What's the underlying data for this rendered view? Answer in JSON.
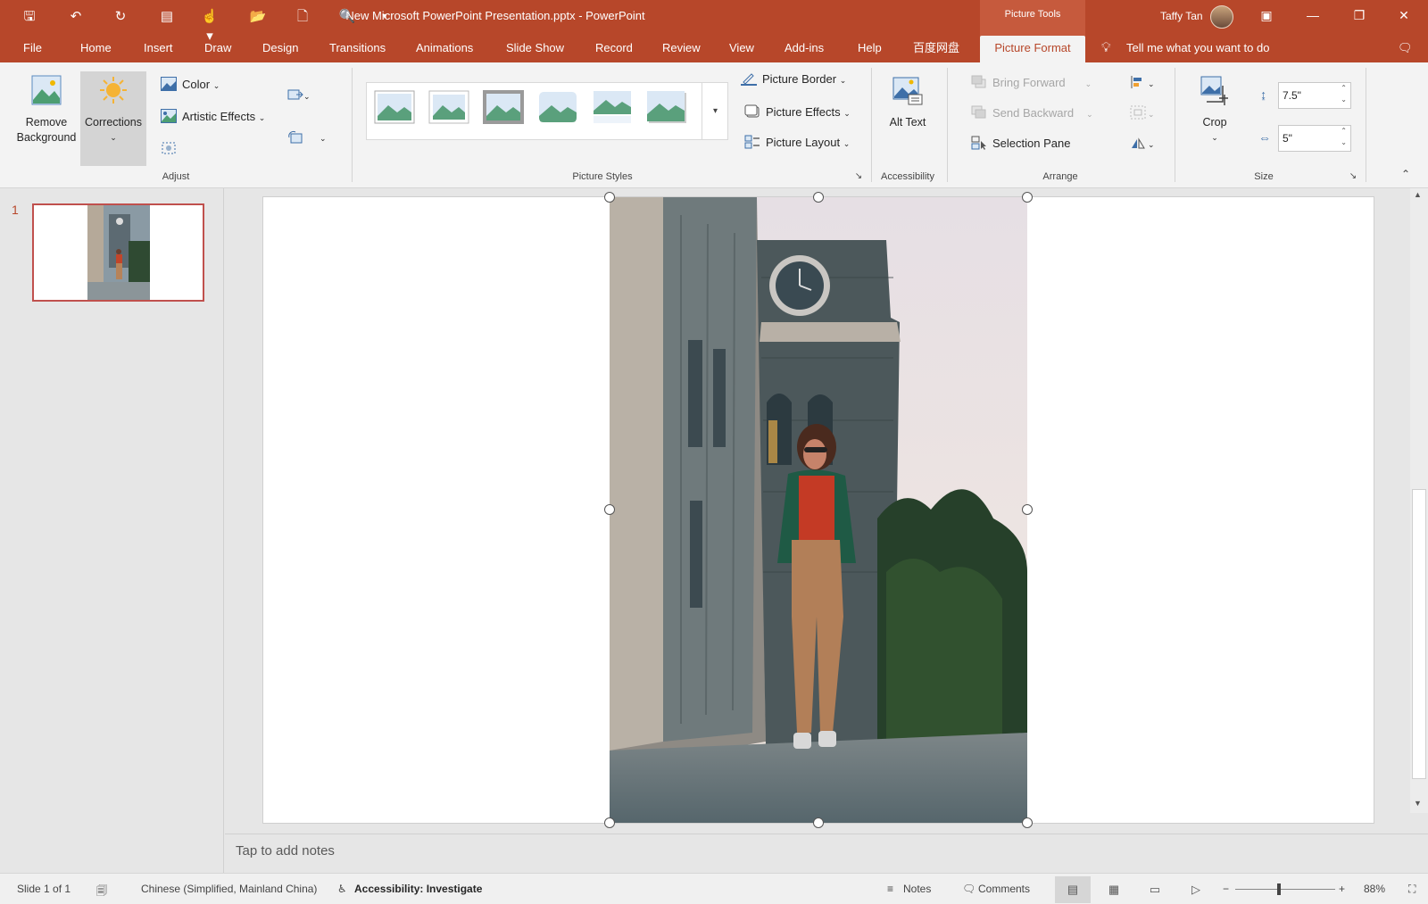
{
  "window": {
    "title": "New Microsoft PowerPoint Presentation.pptx  -  PowerPoint",
    "context_group": "Picture Tools",
    "user_name": "Taffy Tan"
  },
  "tabs": [
    "File",
    "Home",
    "Insert",
    "Draw",
    "Design",
    "Transitions",
    "Animations",
    "Slide Show",
    "Record",
    "Review",
    "View",
    "Add-ins",
    "Help",
    "百度网盘",
    "Picture Format"
  ],
  "active_tab": "Picture Format",
  "tell_me": "Tell me what you want to do",
  "ribbon": {
    "adjust": {
      "remove_background": "Remove Background",
      "corrections": "Corrections",
      "color": "Color",
      "artistic_effects": "Artistic Effects",
      "group_label": "Adjust"
    },
    "picture_styles": {
      "picture_border": "Picture Border",
      "picture_effects": "Picture Effects",
      "picture_layout": "Picture Layout",
      "group_label": "Picture Styles"
    },
    "accessibility": {
      "alt_text": "Alt Text",
      "group_label": "Accessibility"
    },
    "arrange": {
      "bring_forward": "Bring Forward",
      "send_backward": "Send Backward",
      "selection_pane": "Selection Pane",
      "group_label": "Arrange"
    },
    "size": {
      "crop": "Crop",
      "height_value": "7.5\"",
      "width_value": "5\"",
      "group_label": "Size"
    }
  },
  "slides": {
    "number": "1"
  },
  "notes_placeholder": "Tap to add notes",
  "status": {
    "slide_info": "Slide 1 of 1",
    "language": "Chinese (Simplified, Mainland China)",
    "accessibility": "Accessibility: Investigate",
    "notes": "Notes",
    "comments": "Comments",
    "zoom": "88%"
  },
  "colors": {
    "accent": "#b7472a",
    "ribbon_bg": "#f3f3f3"
  }
}
